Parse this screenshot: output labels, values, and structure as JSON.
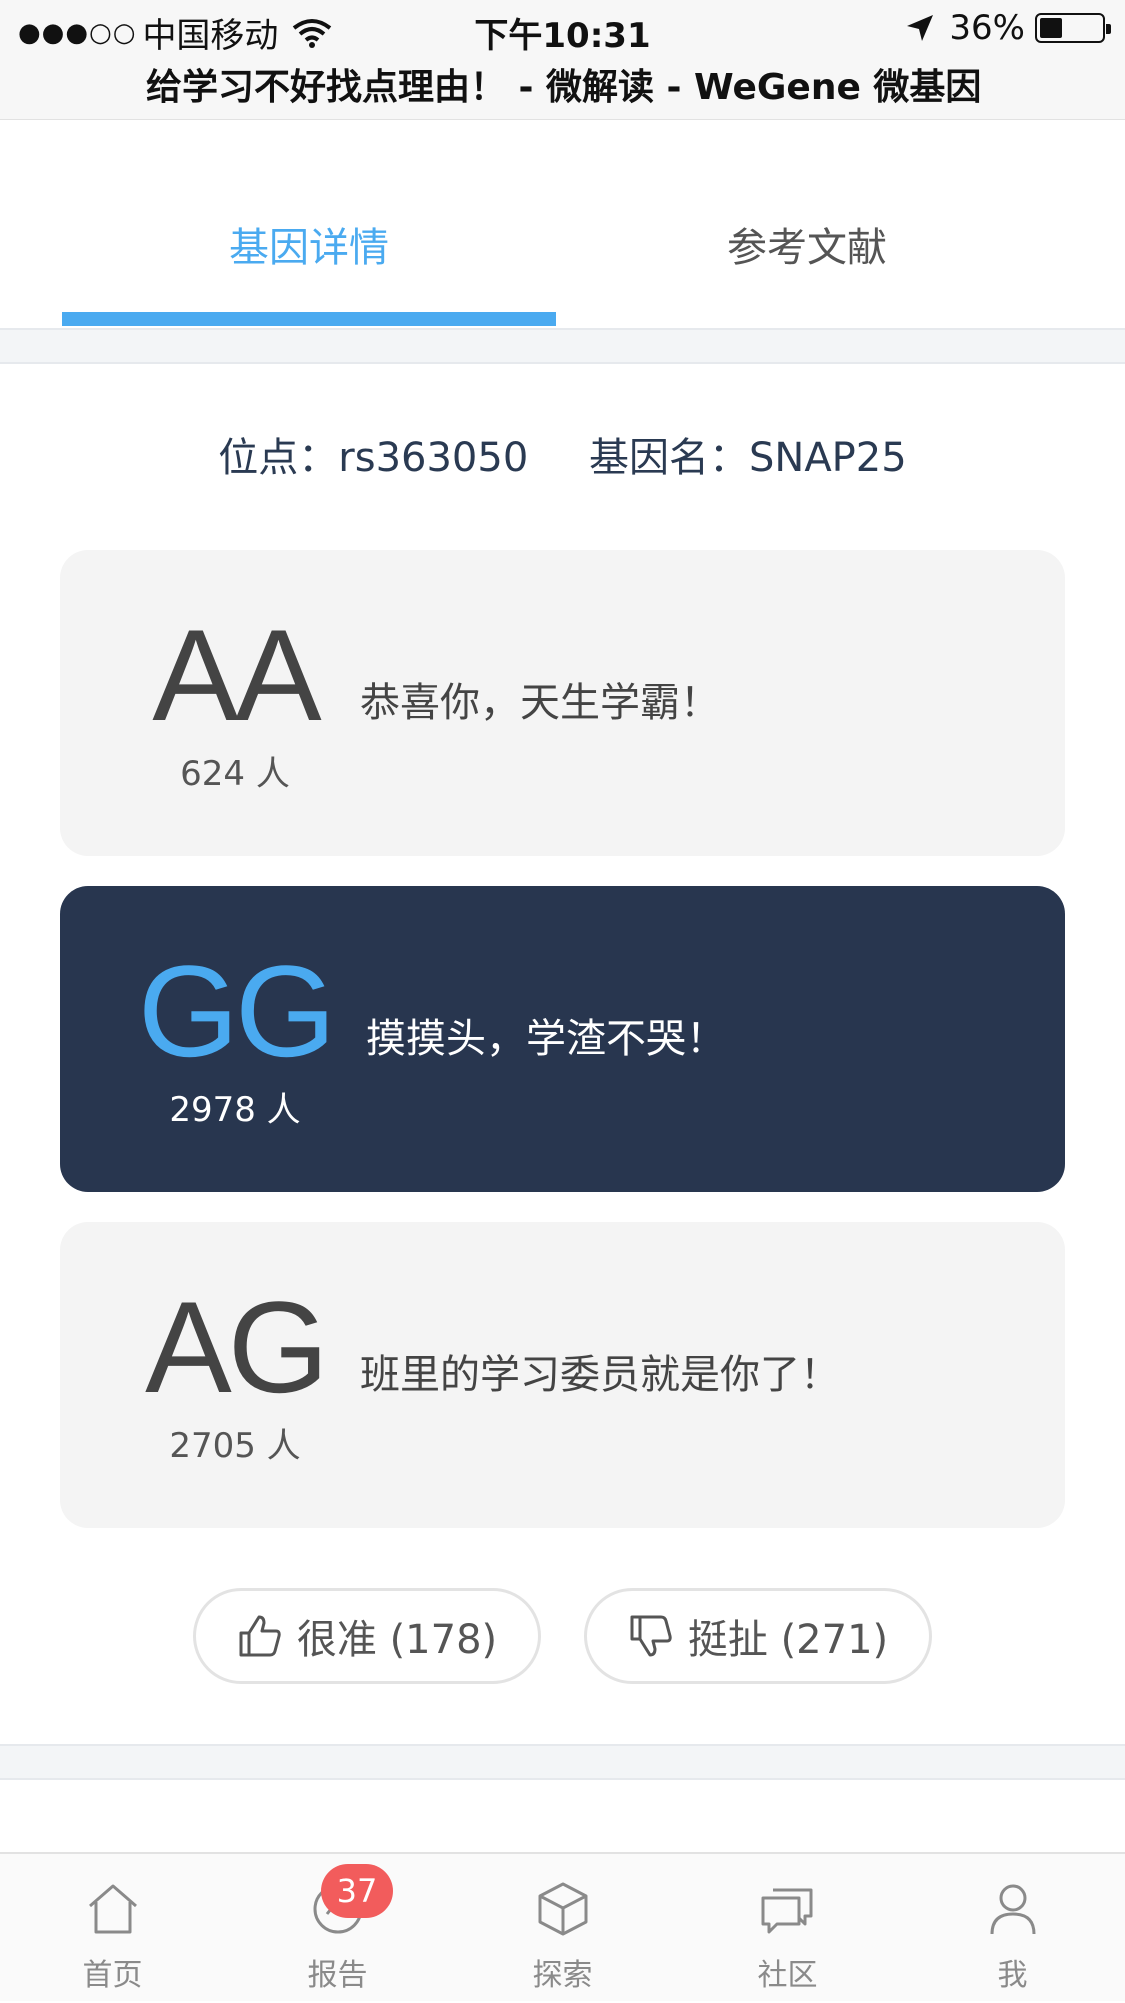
{
  "status_bar": {
    "signal": "●●●○○",
    "carrier": "中国移动",
    "time": "下午10:31",
    "battery_percent": "36%",
    "battery_level": 0.36
  },
  "page_title": "给学习不好找点理由！ - 微解读 - WeGene 微基因",
  "tabs": [
    {
      "label": "基因详情",
      "active": true
    },
    {
      "label": "参考文献",
      "active": false
    }
  ],
  "site": {
    "position_label": "位点：",
    "position_value": "rs363050",
    "gene_label": "基因名：",
    "gene_value": "SNAP25"
  },
  "genotypes": [
    {
      "code": "AA",
      "count": "624 人",
      "description": "恭喜你，天生学霸！",
      "highlighted": false
    },
    {
      "code": "GG",
      "count": "2978 人",
      "description": "摸摸头，学渣不哭！",
      "highlighted": true
    },
    {
      "code": "AG",
      "count": "2705 人",
      "description": "班里的学习委员就是你了！",
      "highlighted": false
    }
  ],
  "votes": {
    "accurate_label": "很准 (178)",
    "inaccurate_label": "挺扯 (271)"
  },
  "bottom_nav": [
    {
      "label": "首页",
      "icon": "home-icon"
    },
    {
      "label": "报告",
      "icon": "report-icon",
      "badge": "37"
    },
    {
      "label": "探索",
      "icon": "cube-icon"
    },
    {
      "label": "社区",
      "icon": "chat-icon"
    },
    {
      "label": "我",
      "icon": "user-icon"
    }
  ],
  "colors": {
    "accent": "#4aaaf0",
    "highlight_card": "#28364f",
    "badge": "#f25c5c"
  }
}
